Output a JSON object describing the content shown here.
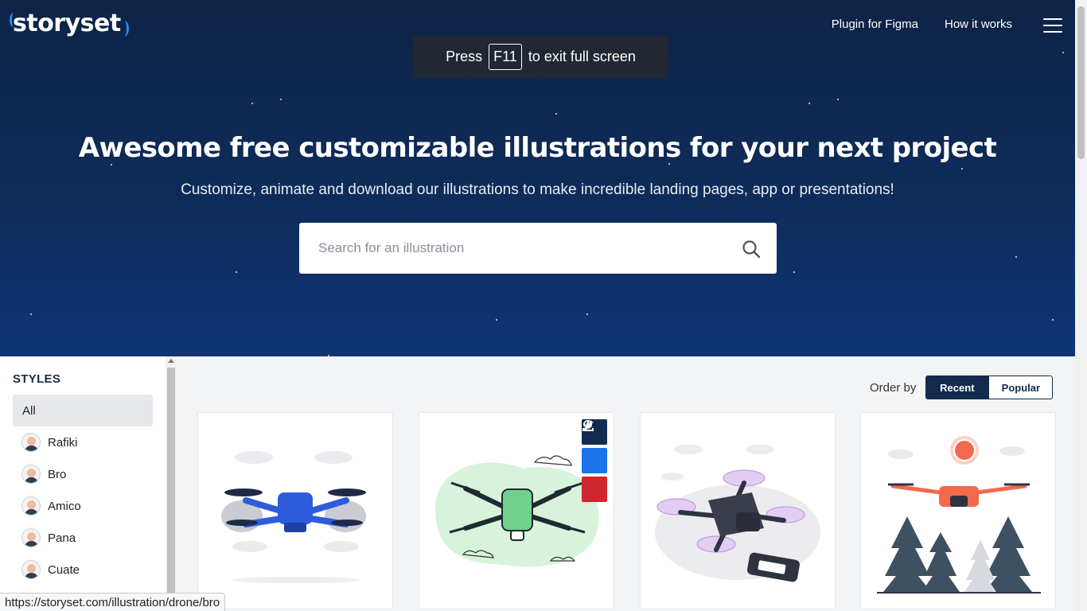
{
  "brand": {
    "name": "storyset"
  },
  "nav": {
    "plugin": "Plugin for Figma",
    "how": "How it works"
  },
  "fullscreen_toast": {
    "pre": "Press",
    "key": "F11",
    "post": "to exit full screen"
  },
  "hero": {
    "title": "Awesome free customizable illustrations for your next project",
    "subtitle": "Customize, animate and download our illustrations to make incredible landing pages, app or presentations!",
    "search_placeholder": "Search for an illustration"
  },
  "sidebar": {
    "heading": "STYLES",
    "items": [
      {
        "label": "All"
      },
      {
        "label": "Rafiki"
      },
      {
        "label": "Bro"
      },
      {
        "label": "Amico"
      },
      {
        "label": "Pana"
      },
      {
        "label": "Cuate"
      }
    ]
  },
  "order": {
    "label": "Order by",
    "recent": "Recent",
    "popular": "Popular"
  },
  "cards": [
    {
      "style": "blue drone",
      "accent": "#2d5bdb"
    },
    {
      "style": "green drone",
      "accent": "#6fd18a"
    },
    {
      "style": "purple drone",
      "accent": "#b78ce0"
    },
    {
      "style": "orange drone",
      "accent": "#f26a4b"
    }
  ],
  "colors": {
    "navy": "#132b4f",
    "pinterest": "#d0252f",
    "action_blue": "#1a73e8"
  },
  "status_url": "https://storyset.com/illustration/drone/bro"
}
